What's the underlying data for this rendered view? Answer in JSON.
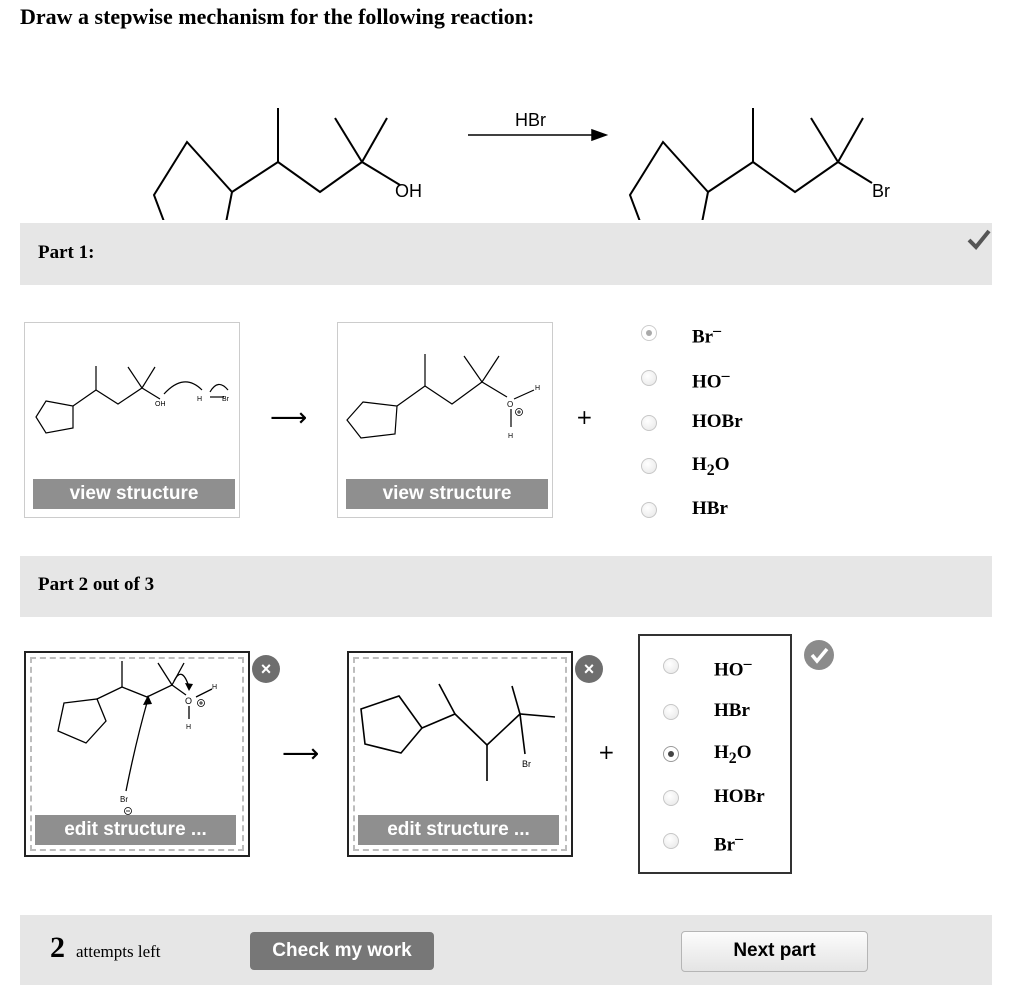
{
  "title": "Draw a stepwise mechanism for the following reaction:",
  "reaction": {
    "reactant_group": "OH",
    "reagent": "HBr",
    "product_group": "Br"
  },
  "part1": {
    "label": "Part 1:",
    "view_button_1": "view structure",
    "view_button_2": "view structure",
    "options": [
      "Br",
      "HO",
      "HOBr",
      "H",
      "HBr"
    ],
    "selected_option": "Br",
    "part1_plus": "+",
    "arrow": "⟶",
    "atoms": {
      "oh": "OH",
      "h": "H",
      "br": "Br",
      "o": "O"
    }
  },
  "part2": {
    "label": "Part 2 out of 3",
    "edit_button_1": "edit structure ...",
    "edit_button_2": "edit structure ...",
    "close_symbol": "×",
    "options": [
      "HO",
      "HBr",
      "H",
      "HOBr",
      "Br"
    ],
    "selected_option": "H2O",
    "plus": "+",
    "arrow": "⟶",
    "atoms": {
      "o": "O",
      "h": "H",
      "br": "Br"
    }
  },
  "footer": {
    "attempts_count": "2",
    "attempts_text": "attempts left",
    "check_button": "Check my work",
    "next_button": "Next part"
  },
  "colors": {
    "bar": "#e6e6e6",
    "button_gray": "#8f8f8f",
    "check_gray": "#777777"
  },
  "icons": {
    "part1_status": "checkmark-icon",
    "part2_status": "checkmark-circle-icon",
    "close": "close-icon"
  }
}
